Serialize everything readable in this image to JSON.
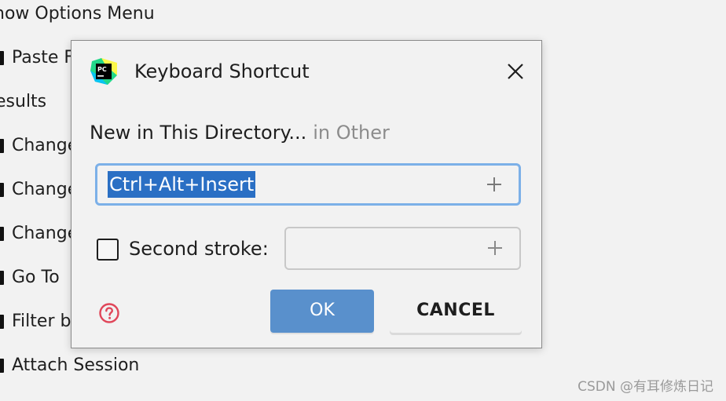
{
  "background_menu": {
    "items": [
      {
        "label": "how Options Menu",
        "bullet": false
      },
      {
        "label": "Paste F",
        "bullet": true
      },
      {
        "label": "esults",
        "bullet": false
      },
      {
        "label": "Change",
        "bullet": true
      },
      {
        "label": "Change",
        "bullet": true
      },
      {
        "label": "Change",
        "bullet": true
      },
      {
        "label": "Go To",
        "bullet": true
      },
      {
        "label": "Filter by",
        "bullet": true
      },
      {
        "label": "Attach Session",
        "bullet": true
      }
    ]
  },
  "watermark": "CSDN @有耳修炼日记",
  "dialog": {
    "title": "Keyboard Shortcut",
    "app_icon": "pycharm-icon",
    "action_name": "New in This Directory...",
    "action_group": "in Other",
    "first_stroke": {
      "value": "Ctrl+Alt+Insert",
      "selected": true
    },
    "second_stroke": {
      "label": "Second stroke:",
      "checked": false,
      "value": ""
    },
    "ok_label": "OK",
    "cancel_label": "CANCEL",
    "colors": {
      "accent": "#5990cc",
      "selection": "#2a6fc4",
      "focus_border": "#7cb0e8",
      "help": "#e0475a"
    }
  }
}
